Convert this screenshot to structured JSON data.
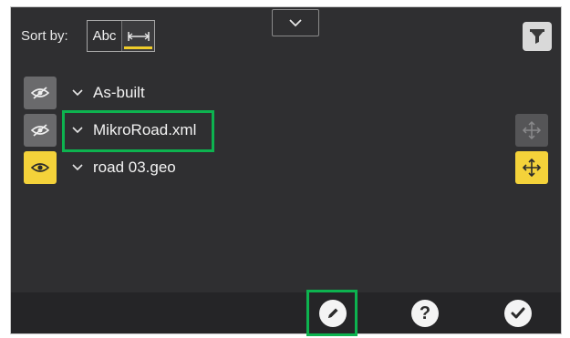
{
  "header": {
    "sort_label": "Sort by:",
    "sort_abc_label": "Abc",
    "sort_distance_icon": "horizontal-measure-icon",
    "filter_icon": "funnel-icon",
    "collapse_icon": "chevron-down-icon"
  },
  "layers": [
    {
      "label": "As-built",
      "visible": false,
      "visibility_icon": "eye-slash-icon",
      "move_enabled": false
    },
    {
      "label": "MikroRoad.xml",
      "visible": false,
      "visibility_icon": "eye-slash-icon",
      "move_enabled": false,
      "move_icon": "move-arrows-icon"
    },
    {
      "label": "road 03.geo",
      "visible": true,
      "visibility_icon": "eye-icon",
      "move_enabled": true,
      "move_icon": "move-arrows-icon"
    }
  ],
  "footer": {
    "edit_icon": "pencil-icon",
    "help_label": "?",
    "confirm_icon": "checkmark-icon"
  },
  "colors": {
    "accent_yellow": "#f4d23a",
    "highlight_green": "#0db34f",
    "panel_bg": "#2f2f31"
  }
}
